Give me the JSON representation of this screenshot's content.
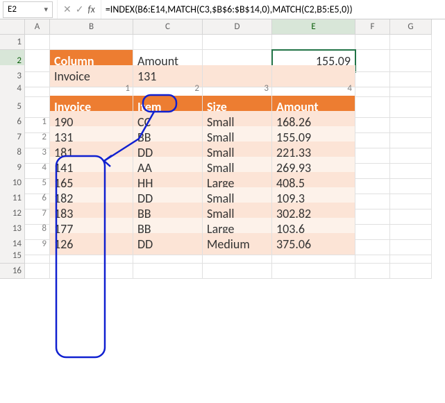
{
  "nameBox": "E2",
  "formula": "=INDEX(B6:E14,MATCH(C3,$B$6:$B$14,0),MATCH(C2,B5:E5,0))",
  "colHeaders": [
    "A",
    "B",
    "C",
    "D",
    "E",
    "F",
    "G"
  ],
  "rowCount": 16,
  "labels": {
    "column": "Column",
    "invoice": "Invoice"
  },
  "lookup": {
    "columnValue": "Amount",
    "invoiceValue": "131",
    "result": "155.09"
  },
  "colIdx": [
    "1",
    "2",
    "3",
    "4"
  ],
  "tableHeaders": {
    "invoice": "Invoice",
    "item": "Item",
    "size": "Size",
    "amount": "Amount"
  },
  "rows": [
    {
      "n": "1",
      "inv": "190",
      "item": "CC",
      "size": "Small",
      "amt": "168.26"
    },
    {
      "n": "2",
      "inv": "131",
      "item": "BB",
      "size": "Small",
      "amt": "155.09"
    },
    {
      "n": "3",
      "inv": "181",
      "item": "DD",
      "size": "Small",
      "amt": "221.33"
    },
    {
      "n": "4",
      "inv": "141",
      "item": "AA",
      "size": "Small",
      "amt": "269.93"
    },
    {
      "n": "5",
      "inv": "165",
      "item": "HH",
      "size": "Large",
      "amt": "408.5"
    },
    {
      "n": "6",
      "inv": "182",
      "item": "DD",
      "size": "Small",
      "amt": "109.3"
    },
    {
      "n": "7",
      "inv": "183",
      "item": "BB",
      "size": "Small",
      "amt": "302.82"
    },
    {
      "n": "8",
      "inv": "177",
      "item": "BB",
      "size": "Large",
      "amt": "103.6"
    },
    {
      "n": "9",
      "inv": "126",
      "item": "DD",
      "size": "Medium",
      "amt": "375.06"
    }
  ]
}
